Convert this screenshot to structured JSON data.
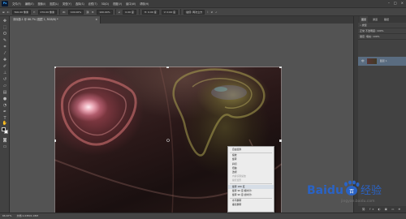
{
  "menubar": {
    "logo": "Ps",
    "items": [
      "文件(F)",
      "编辑(E)",
      "图像(I)",
      "图层(L)",
      "类型(Y)",
      "选择(S)",
      "滤镜(T)",
      "3D(D)",
      "视图(V)",
      "窗口(W)",
      "帮助(H)"
    ],
    "window_controls": [
      "–",
      "□",
      "×"
    ]
  },
  "options": {
    "x_label": "X:",
    "x_value": "500.00 像素",
    "y_label": "Y:",
    "y_value": "270.00 像素",
    "w_label": "W:",
    "w_value": "100.00%",
    "h_label": "H:",
    "h_value": "100.00%",
    "angle_value": "0.00 度",
    "h_skew": "H: 0.00 度",
    "v_skew": "V: 0.00 度",
    "interp": "插值: 两次立方"
  },
  "tabs": [
    {
      "label": "未标题-1 @ 66.7% (图层 1, RGB/8) *",
      "close": "×"
    }
  ],
  "context_menu": {
    "items": [
      {
        "label": "自由变换",
        "disabled": false
      },
      {
        "label": "缩放",
        "disabled": false
      },
      {
        "label": "旋转",
        "disabled": false
      },
      {
        "label": "斜切",
        "disabled": false
      },
      {
        "label": "扭曲",
        "disabled": false
      },
      {
        "label": "透视",
        "disabled": false
      },
      {
        "label": "内容识别缩放",
        "disabled": true
      },
      {
        "label": "操控变形",
        "disabled": true
      },
      {
        "label": "旋转 180 度",
        "disabled": false,
        "highlight": true
      },
      {
        "label": "旋转 90 度(顺时针)",
        "disabled": false
      },
      {
        "label": "旋转 90 度(逆时针)",
        "disabled": false
      },
      {
        "label": "水平翻转",
        "disabled": false
      },
      {
        "label": "垂直翻转",
        "disabled": false
      }
    ]
  },
  "layers_panel": {
    "tabs": [
      "图层",
      "通道",
      "路径"
    ],
    "kind_label": "类型",
    "blend_mode": "正常",
    "opacity": "不透明度: 100%",
    "lock_label": "锁定:",
    "fill": "填充: 100%",
    "layer_name": "图层 1",
    "eye": "👁",
    "footer_icons": "⛓ fx ◐ ▣ ▭ ⊕ 🗑"
  },
  "status": {
    "zoom": "66.67%",
    "doc": "文档:1.03M/1.03M"
  },
  "watermark": {
    "brand": "Baidu",
    "paw": "百",
    "cn": "经验",
    "url": "jingyan.baidu.com"
  },
  "colors": {
    "accent": "#31a8ff",
    "watermark_blue": "#2a63c5",
    "watermark_red": "#d6343a"
  }
}
